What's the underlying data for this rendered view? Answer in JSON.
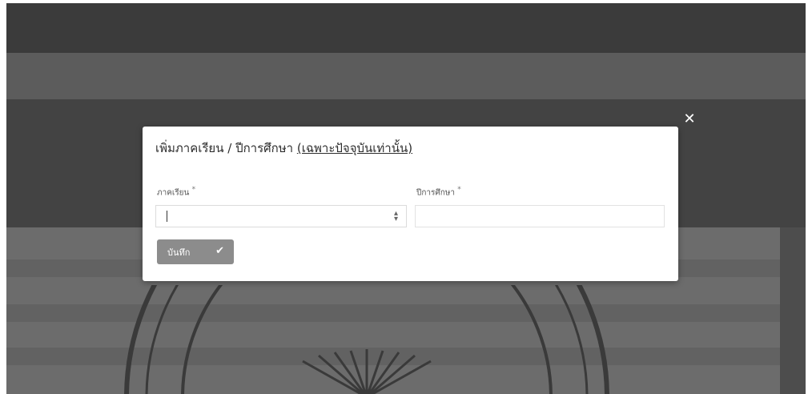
{
  "modal": {
    "title": "เพิ่มภาคเรียน / ปีการศึกษา",
    "title_note": "(เฉพาะปัจจุบันเท่านั้น)",
    "close_icon": "close-icon",
    "fields": [
      {
        "label": "ภาคเรียน",
        "required_mark": "*",
        "type": "select",
        "value": ""
      },
      {
        "label": "ปีการศึกษา",
        "required_mark": "*",
        "type": "text",
        "value": ""
      }
    ],
    "save_button": {
      "label": "บันทึก",
      "icon": "check-icon"
    }
  },
  "colors": {
    "backdrop": "#4d4d4d",
    "modal_background": "#ffffff",
    "button_background": "#8c8c8c"
  }
}
